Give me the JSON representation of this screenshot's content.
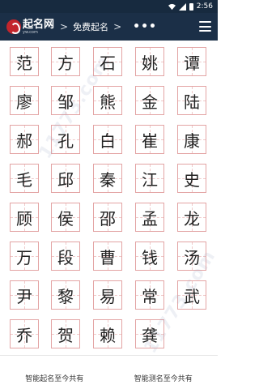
{
  "status": {
    "time": "2:56"
  },
  "nav": {
    "logo_title": "起名网",
    "logo_domain": "yw.com",
    "separator": ">",
    "breadcrumb": "免费起名",
    "more": "•••"
  },
  "surnames": [
    [
      "范",
      "方",
      "石",
      "姚",
      "谭"
    ],
    [
      "廖",
      "邹",
      "熊",
      "金",
      "陆"
    ],
    [
      "郝",
      "孔",
      "白",
      "崔",
      "康"
    ],
    [
      "毛",
      "邱",
      "秦",
      "江",
      "史"
    ],
    [
      "顾",
      "侯",
      "邵",
      "孟",
      "龙"
    ],
    [
      "万",
      "段",
      "曹",
      "钱",
      "汤"
    ],
    [
      "尹",
      "黎",
      "易",
      "常",
      "武"
    ],
    [
      "乔",
      "贺",
      "赖",
      "龚",
      ""
    ]
  ],
  "watermark": "11773.com",
  "footer": {
    "left": "智能起名至今共有",
    "right": "智能测名至今共有"
  },
  "colors": {
    "nav_bg": "#1b2f47",
    "cell_border": "#e3a4a4",
    "logo_red": "#c3252c"
  }
}
